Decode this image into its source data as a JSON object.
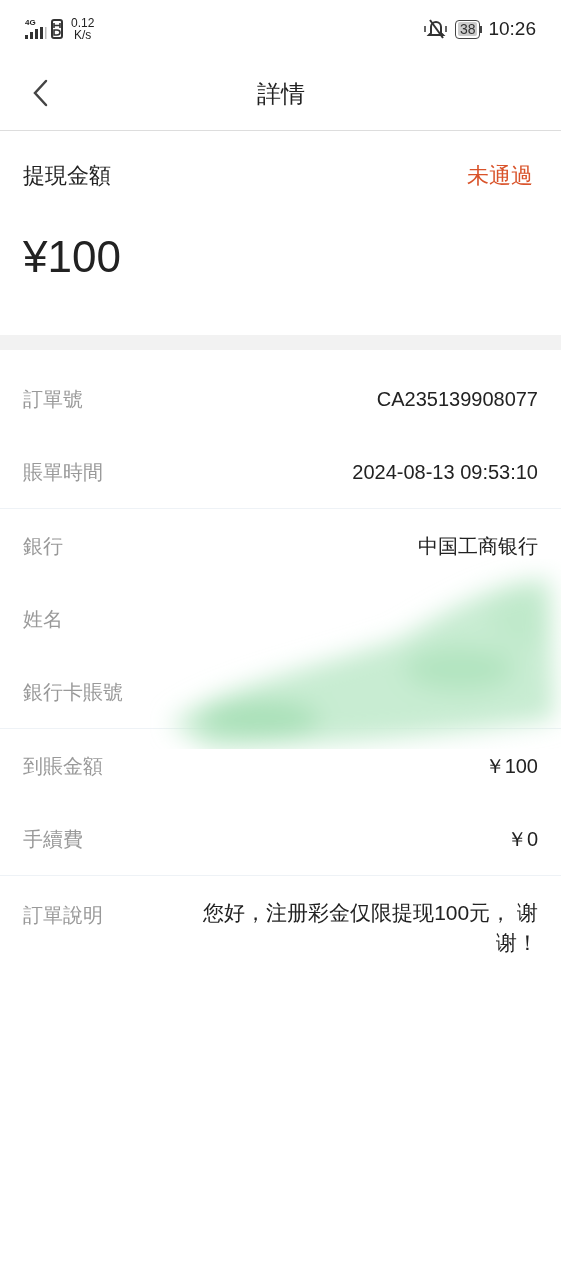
{
  "status_bar": {
    "network": "4G",
    "speed_value": "0.12",
    "speed_unit": "K/s",
    "battery": "38",
    "time": "10:26"
  },
  "header": {
    "title": "詳情"
  },
  "summary": {
    "label": "提現金額",
    "status": "未通過",
    "amount": "¥100"
  },
  "groups": [
    {
      "rows": [
        {
          "label": "訂單號",
          "value": "CA235139908077"
        },
        {
          "label": "賬單時間",
          "value": "2024-08-13 09:53:10"
        }
      ]
    },
    {
      "rows": [
        {
          "label": "銀行",
          "value": "中国工商银行"
        },
        {
          "label": "姓名"
        },
        {
          "label": "銀行卡賬號"
        }
      ],
      "redacted": true
    },
    {
      "rows": [
        {
          "label": "到賬金額",
          "value": "￥100"
        },
        {
          "label": "手續費",
          "value": "￥0"
        }
      ]
    },
    {
      "rows": [
        {
          "label": "訂單說明",
          "value": "您好，注册彩金仅限提现100元， 谢谢！",
          "kind": "note"
        }
      ]
    }
  ]
}
